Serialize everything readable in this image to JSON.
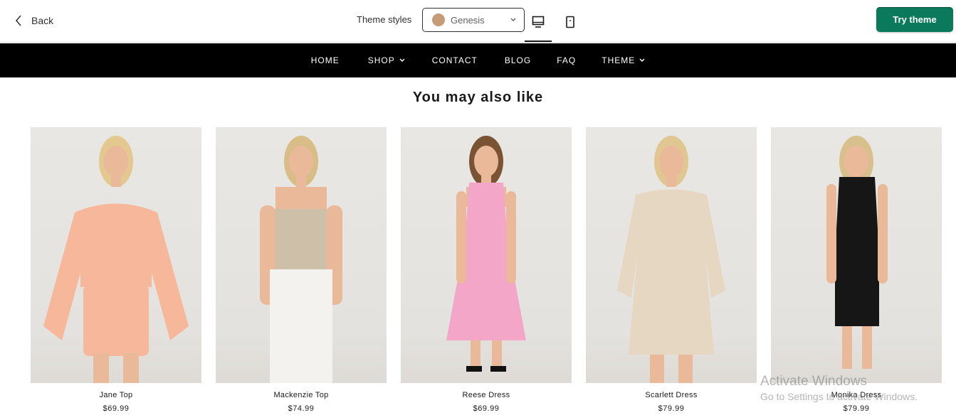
{
  "topbar": {
    "back_label": "Back",
    "theme_styles_label": "Theme styles",
    "selected_style": "Genesis",
    "selected_style_color": "#c79b77",
    "try_theme_label": "Try theme",
    "try_theme_color": "#0b7a5c",
    "active_device": "desktop-icon"
  },
  "nav": {
    "items": [
      {
        "label": "HOME",
        "dropdown": false
      },
      {
        "label": "SHOP",
        "dropdown": true
      },
      {
        "label": "CONTACT",
        "dropdown": false
      },
      {
        "label": "BLOG",
        "dropdown": false
      },
      {
        "label": "FAQ",
        "dropdown": false
      },
      {
        "label": "THEME",
        "dropdown": true
      }
    ]
  },
  "section": {
    "title": "You may also like"
  },
  "products": [
    {
      "name": "Jane Top",
      "price": "$69.99",
      "outfit_color": "#f6b79a",
      "icon": "model-in-peach-knit-set"
    },
    {
      "name": "Mackenzie Top",
      "price": "$74.99",
      "outfit_color": "#cdbfa8",
      "icon": "model-in-beige-top-white-pants"
    },
    {
      "name": "Reese Dress",
      "price": "$69.99",
      "outfit_color": "#f4a6c8",
      "icon": "model-in-pink-dress"
    },
    {
      "name": "Scarlett Dress",
      "price": "$79.99",
      "outfit_color": "#e6d7c3",
      "icon": "model-in-cream-shirt-dress"
    },
    {
      "name": "Monika Dress",
      "price": "$79.99",
      "outfit_color": "#161616",
      "icon": "model-in-black-dress"
    }
  ],
  "watermark": {
    "title": "Activate Windows",
    "subtitle": "Go to Settings to activate Windows."
  }
}
